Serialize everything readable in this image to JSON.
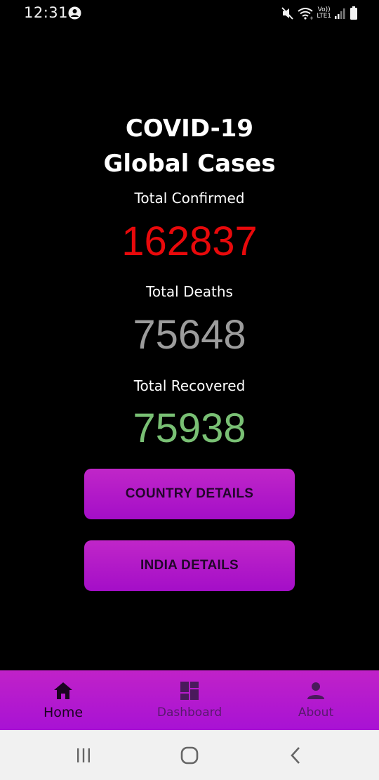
{
  "status_bar": {
    "time": "12:31",
    "left_icon": "account-circle-icon",
    "right_icons": [
      "mute-icon",
      "wifi-icon",
      "volte-lte-icon",
      "signal-icon",
      "battery-icon"
    ],
    "network_label_top": "Vo))",
    "network_label_bottom": "LTE1"
  },
  "main": {
    "title_line1": "COVID-19",
    "title_line2": "Global Cases",
    "confirmed_label": "Total Confirmed",
    "confirmed_value": "162837",
    "deaths_label": "Total Deaths",
    "deaths_value": "75648",
    "recovered_label": "Total Recovered",
    "recovered_value": "75938",
    "colors": {
      "confirmed": "#e8090b",
      "deaths": "#9c9c9c",
      "recovered": "#79c074",
      "button_gradient_top": "#c026c8",
      "button_gradient_bottom": "#a40ec8"
    }
  },
  "buttons": {
    "country_details": "COUNTRY DETAILS",
    "india_details": "INDIA DETAILS"
  },
  "bottom_nav": {
    "items": [
      {
        "label": "Home",
        "icon": "home-icon",
        "active": true
      },
      {
        "label": "Dashboard",
        "icon": "dashboard-icon",
        "active": false
      },
      {
        "label": "About",
        "icon": "person-icon",
        "active": false
      }
    ]
  },
  "system_nav": {
    "icons": [
      "recents-icon",
      "home-circle-icon",
      "back-chevron-icon"
    ]
  }
}
